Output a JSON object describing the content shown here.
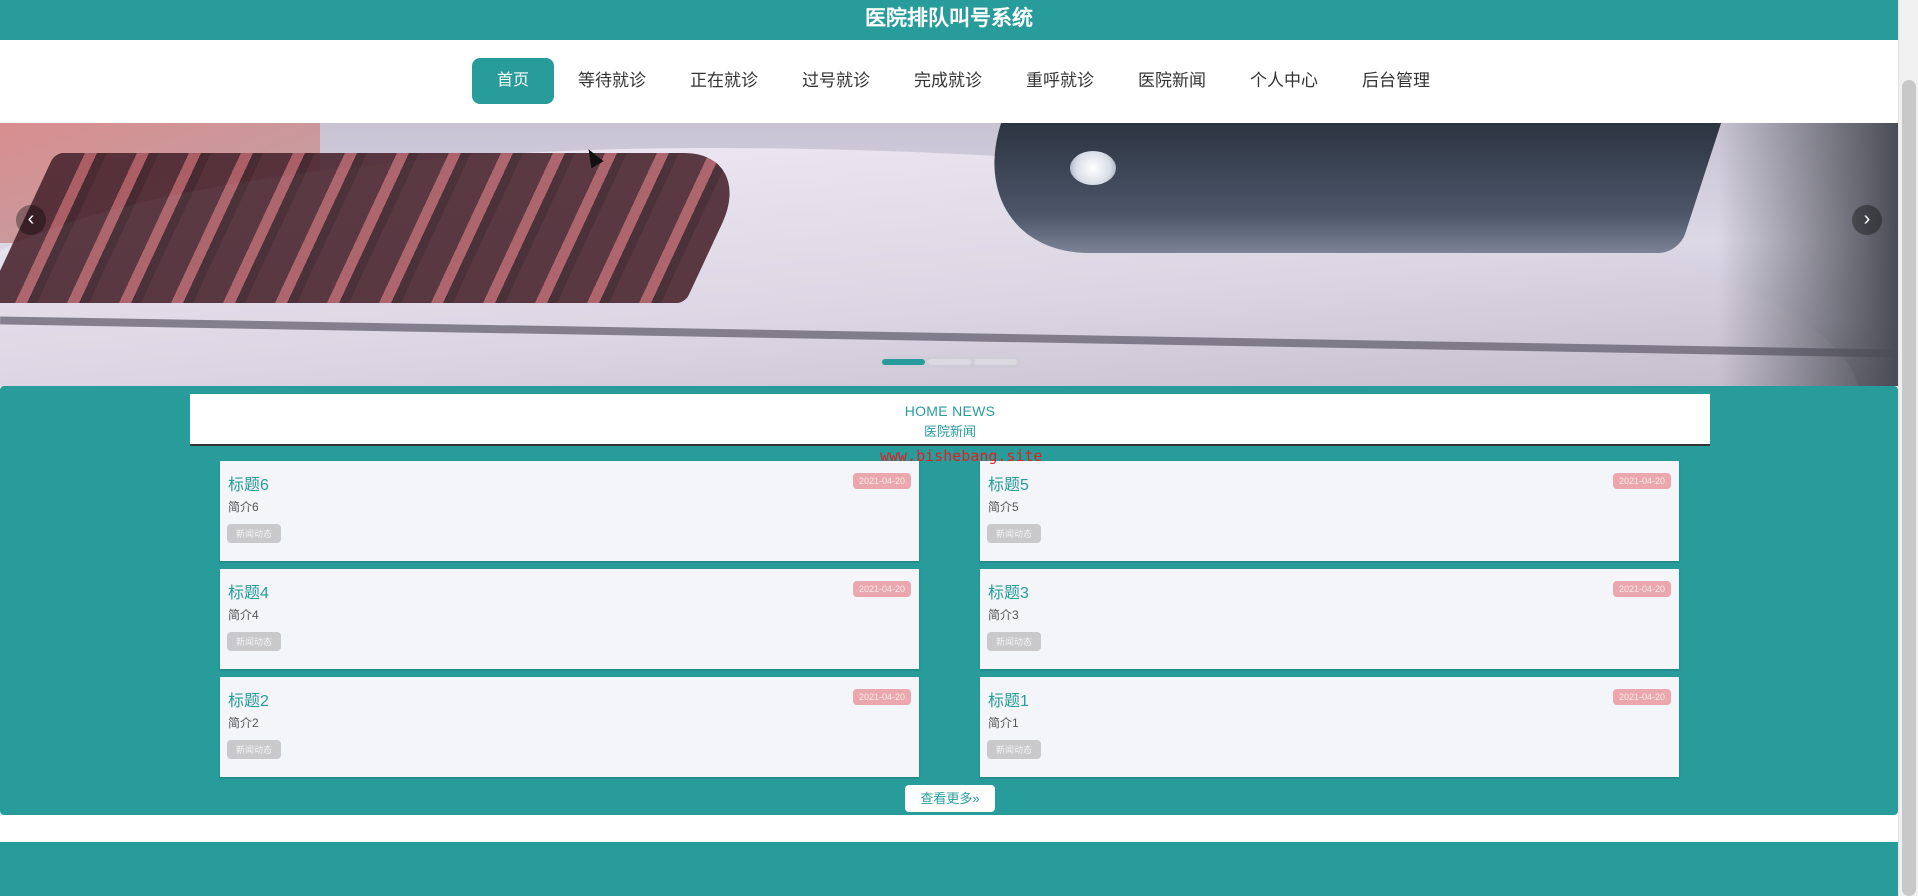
{
  "header": {
    "title": "医院排队叫号系统"
  },
  "nav": {
    "items": [
      {
        "label": "首页",
        "active": true
      },
      {
        "label": "等待就诊"
      },
      {
        "label": "正在就诊"
      },
      {
        "label": "过号就诊"
      },
      {
        "label": "完成就诊"
      },
      {
        "label": "重呼就诊"
      },
      {
        "label": "医院新闻"
      },
      {
        "label": "个人中心"
      },
      {
        "label": "后台管理"
      }
    ]
  },
  "banner": {
    "prev_icon": "chevron-left-icon",
    "next_icon": "chevron-right-icon",
    "slides": 3,
    "active_slide": 1
  },
  "news": {
    "title_en": "HOME NEWS",
    "title_cn": "医院新闻",
    "items": [
      {
        "title": "标题6",
        "intro": "简介6",
        "tag": "新闻动态",
        "date": "2021-04-20"
      },
      {
        "title": "标题5",
        "intro": "简介5",
        "tag": "新闻动态",
        "date": "2021-04-20"
      },
      {
        "title": "标题4",
        "intro": "简介4",
        "tag": "新闻动态",
        "date": "2021-04-20"
      },
      {
        "title": "标题3",
        "intro": "简介3",
        "tag": "新闻动态",
        "date": "2021-04-20"
      },
      {
        "title": "标题2",
        "intro": "简介2",
        "tag": "新闻动态",
        "date": "2021-04-20"
      },
      {
        "title": "标题1",
        "intro": "简介1",
        "tag": "新闻动态",
        "date": "2021-04-20"
      }
    ],
    "more_label": "查看更多»"
  },
  "watermark": "www.bishebang.site",
  "colors": {
    "primary": "#279c9b",
    "date_badge": "#eaa7ad",
    "tag_badge": "#c9c9cc",
    "card_bg": "#f4f5f9"
  }
}
